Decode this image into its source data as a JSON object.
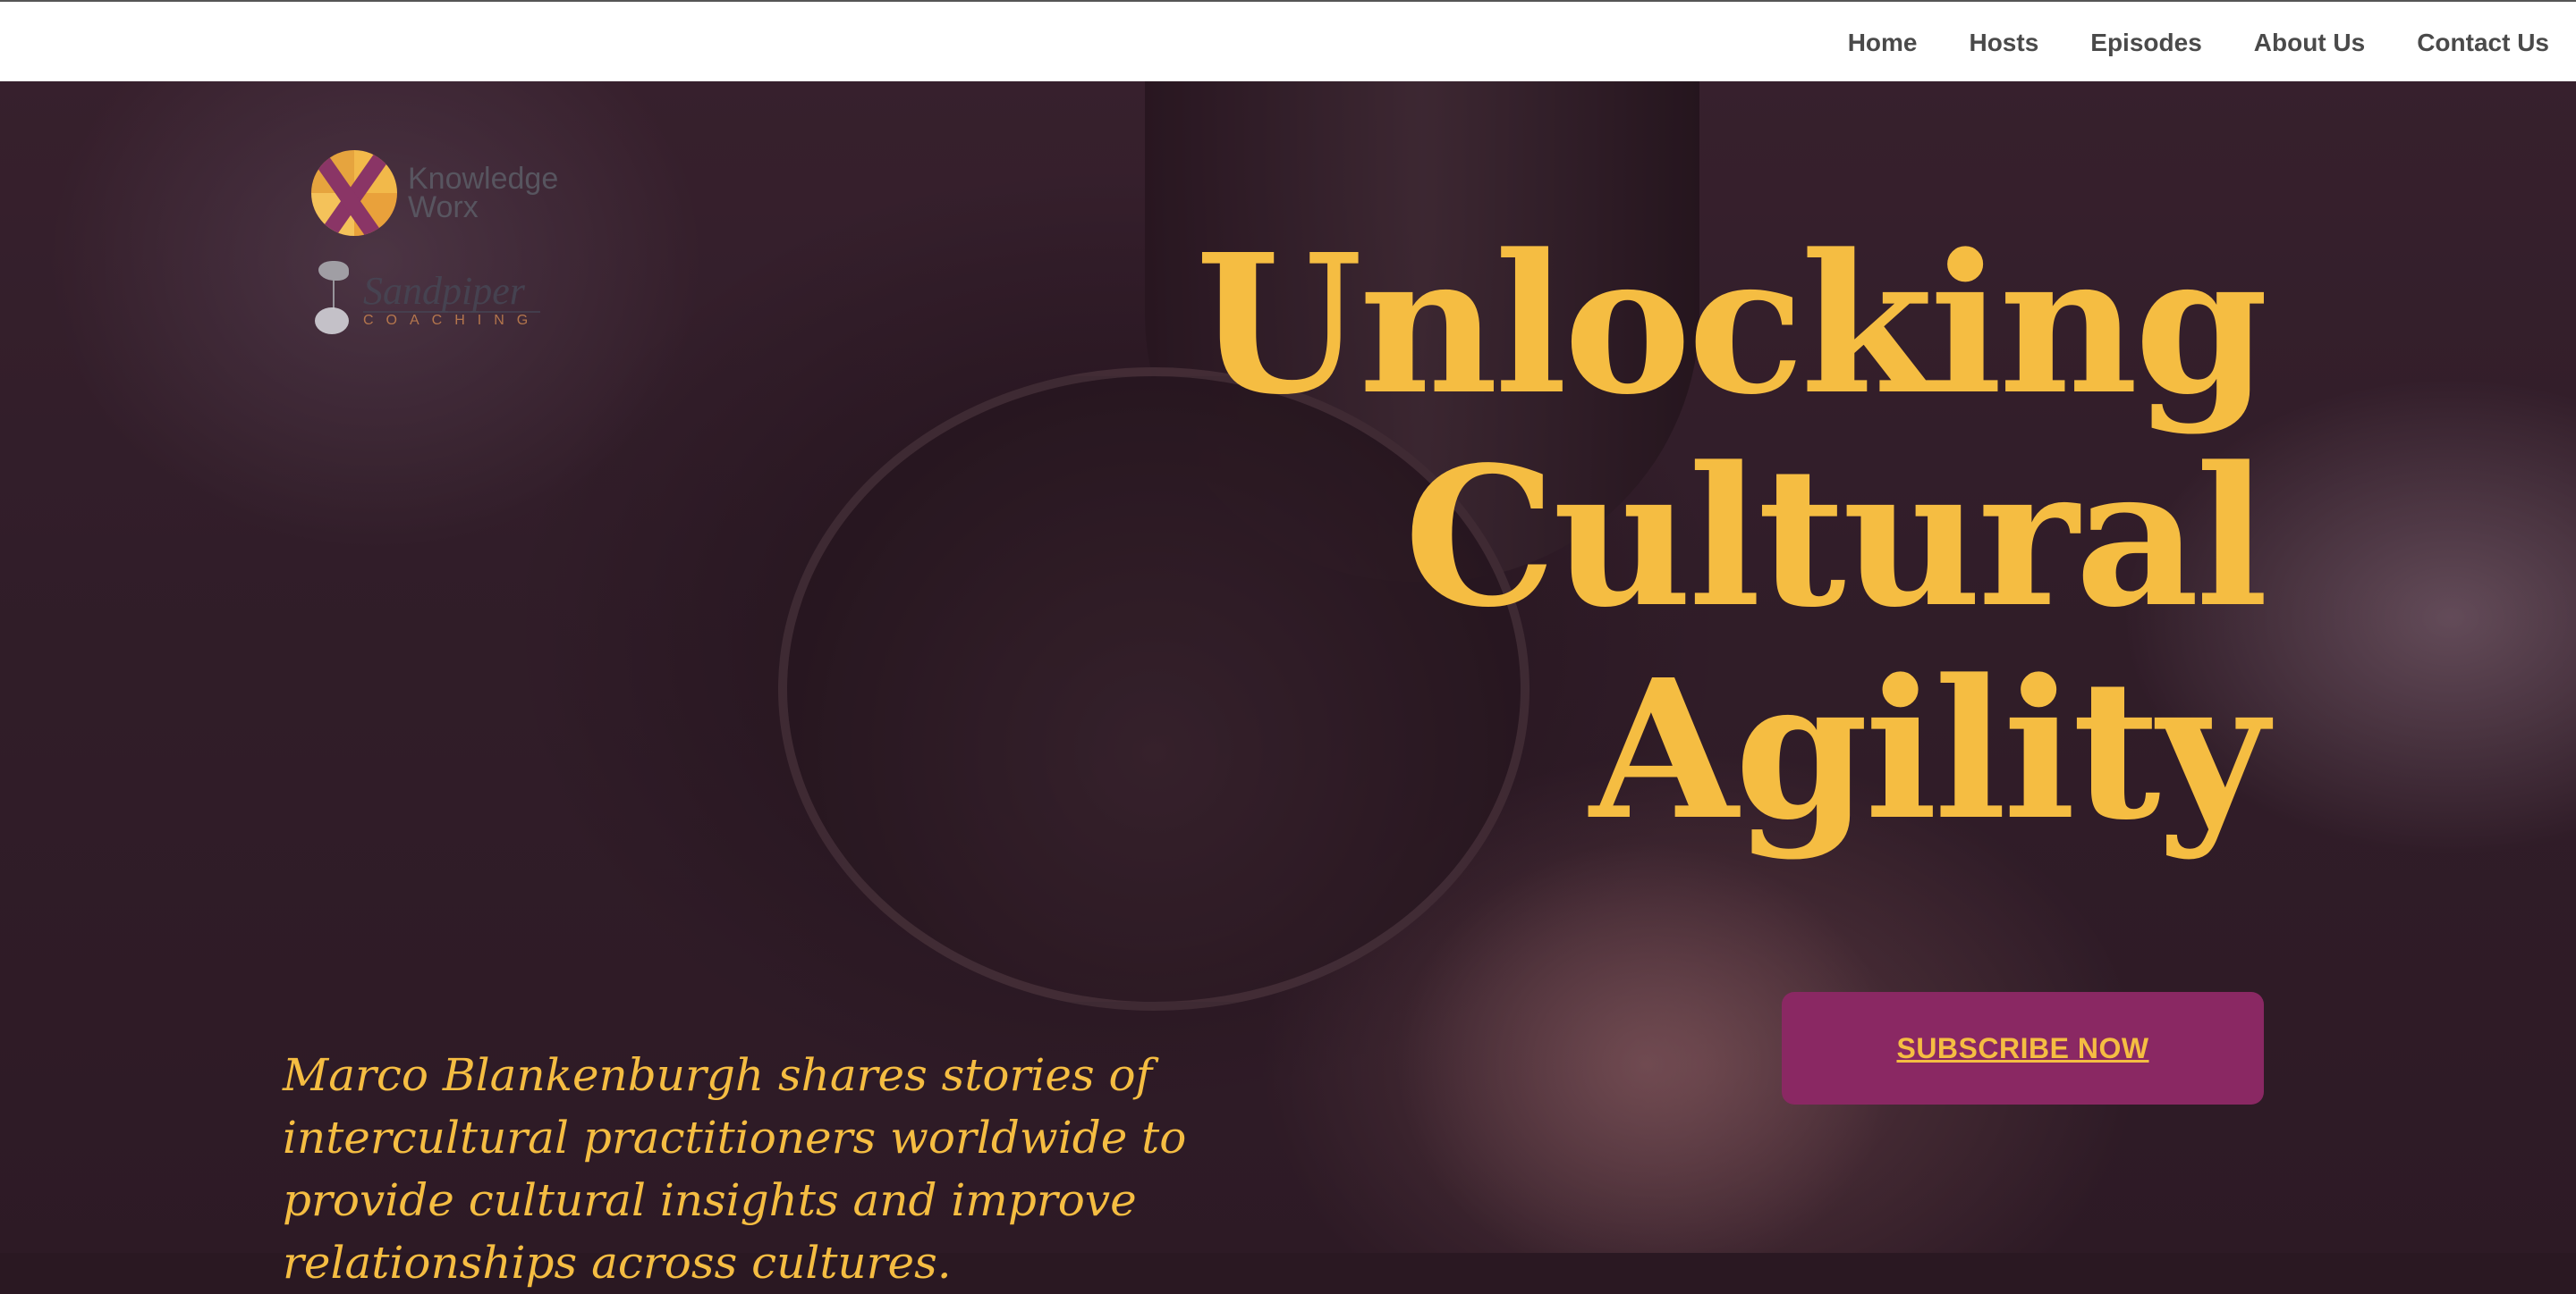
{
  "nav": {
    "items": [
      "Home",
      "Hosts",
      "Episodes",
      "About Us",
      "Contact Us"
    ]
  },
  "logos": {
    "knowledge_worx": {
      "line1": "Knowledge",
      "line2": "Worx"
    },
    "sandpiper": {
      "name": "Sandpiper",
      "sub": "COACHING"
    }
  },
  "hero": {
    "headline_lines": [
      "Unlocking",
      "Cultural",
      "Agility"
    ],
    "subscribe_label": "SUBSCRIBE NOW",
    "intro": "Marco Blankenburgh shares stories of intercultural practitioners worldwide to provide cultural insights and improve relationships across cultures."
  },
  "colors": {
    "accent": "#f5bd42",
    "button": "#8a2863",
    "nav_text": "#4a4a4a"
  }
}
